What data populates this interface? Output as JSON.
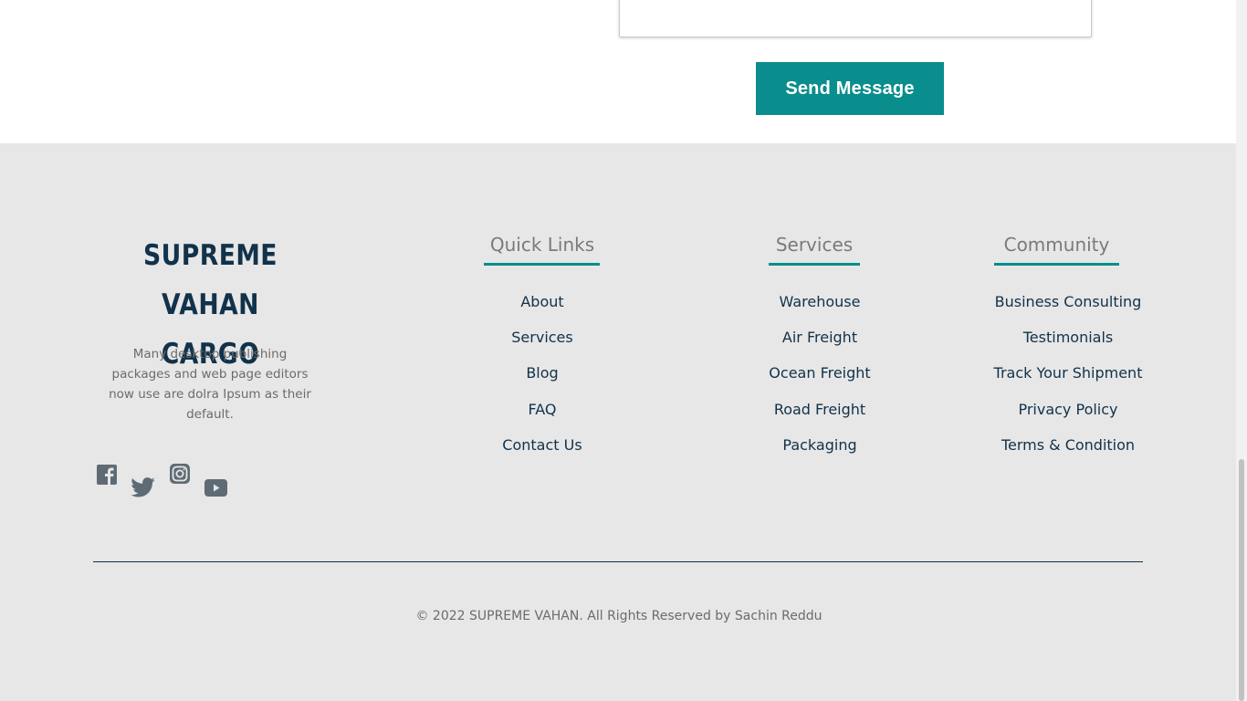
{
  "contact_form": {
    "message_value": "",
    "send_label": "Send Message"
  },
  "footer": {
    "brand_line1": "SUPREME VAHAN",
    "brand_line2": "CARGO",
    "description": "Many desktop publishing packages and web page editors now use are dolra Ipsum as their default.",
    "social": [
      "facebook-icon",
      "twitter-icon",
      "instagram-icon",
      "youtube-icon"
    ],
    "quick_links": {
      "heading": "Quick Links",
      "items": [
        "About",
        "Services",
        "Blog",
        "FAQ",
        "Contact Us"
      ]
    },
    "services": {
      "heading": "Services",
      "items": [
        "Warehouse",
        "Air Freight",
        "Ocean Freight",
        "Road Freight",
        "Packaging"
      ]
    },
    "community": {
      "heading": "Community",
      "items": [
        "Business Consulting",
        "Testimonials",
        "Track Your Shipment",
        "Privacy Policy",
        "Terms & Condition"
      ]
    },
    "copyright": "© 2022 SUPREME VAHAN. All Rights Reserved by Sachin Reddu"
  },
  "colors": {
    "accent": "#0a8d8d",
    "navy": "#11324a",
    "footer_bg": "#e7e7e7",
    "muted_text": "#6b6b6b",
    "icon_gray": "#5f6b74"
  }
}
